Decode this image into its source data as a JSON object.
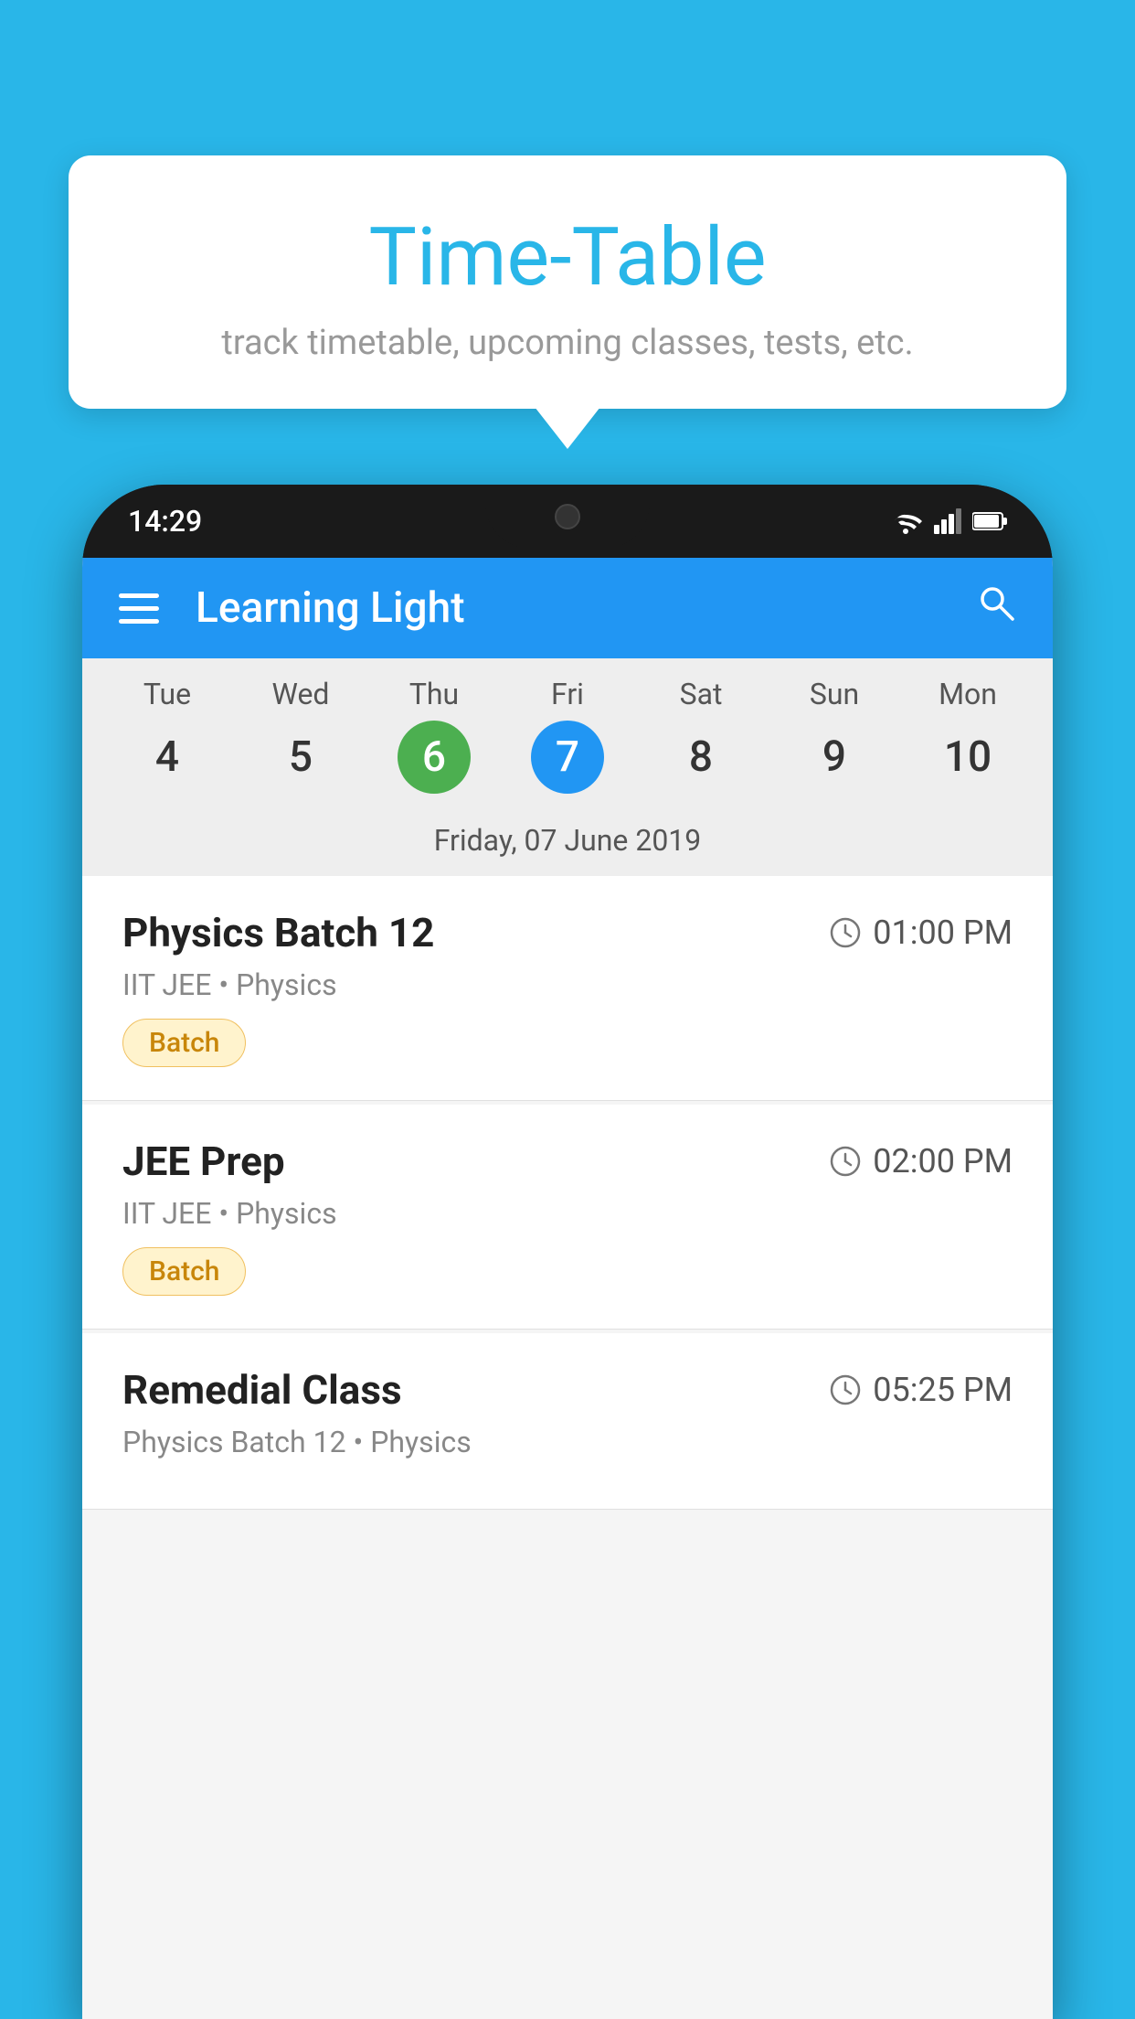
{
  "background_color": "#29b6e8",
  "tooltip": {
    "title": "Time-Table",
    "subtitle": "track timetable, upcoming classes, tests, etc."
  },
  "phone": {
    "status_bar": {
      "time": "14:29"
    },
    "app_bar": {
      "title": "Learning Light"
    },
    "calendar": {
      "days": [
        {
          "name": "Tue",
          "num": "4",
          "state": "normal"
        },
        {
          "name": "Wed",
          "num": "5",
          "state": "normal"
        },
        {
          "name": "Thu",
          "num": "6",
          "state": "today"
        },
        {
          "name": "Fri",
          "num": "7",
          "state": "selected"
        },
        {
          "name": "Sat",
          "num": "8",
          "state": "normal"
        },
        {
          "name": "Sun",
          "num": "9",
          "state": "normal"
        },
        {
          "name": "Mon",
          "num": "10",
          "state": "normal"
        }
      ],
      "selected_date_label": "Friday, 07 June 2019"
    },
    "events": [
      {
        "title": "Physics Batch 12",
        "time": "01:00 PM",
        "meta": "IIT JEE • Physics",
        "badge": "Batch"
      },
      {
        "title": "JEE Prep",
        "time": "02:00 PM",
        "meta": "IIT JEE • Physics",
        "badge": "Batch"
      },
      {
        "title": "Remedial Class",
        "time": "05:25 PM",
        "meta": "Physics Batch 12 • Physics",
        "badge": null
      }
    ]
  }
}
